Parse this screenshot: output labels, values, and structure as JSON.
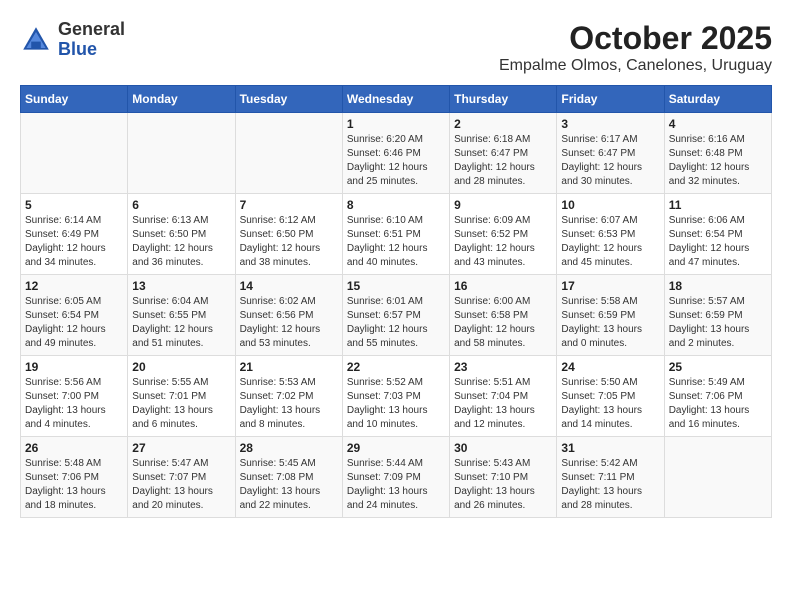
{
  "header": {
    "logo": {
      "general": "General",
      "blue": "Blue"
    },
    "title": "October 2025",
    "subtitle": "Empalme Olmos, Canelones, Uruguay"
  },
  "days_of_week": [
    "Sunday",
    "Monday",
    "Tuesday",
    "Wednesday",
    "Thursday",
    "Friday",
    "Saturday"
  ],
  "weeks": [
    [
      {
        "day": "",
        "info": ""
      },
      {
        "day": "",
        "info": ""
      },
      {
        "day": "",
        "info": ""
      },
      {
        "day": "1",
        "info": "Sunrise: 6:20 AM\nSunset: 6:46 PM\nDaylight: 12 hours\nand 25 minutes."
      },
      {
        "day": "2",
        "info": "Sunrise: 6:18 AM\nSunset: 6:47 PM\nDaylight: 12 hours\nand 28 minutes."
      },
      {
        "day": "3",
        "info": "Sunrise: 6:17 AM\nSunset: 6:47 PM\nDaylight: 12 hours\nand 30 minutes."
      },
      {
        "day": "4",
        "info": "Sunrise: 6:16 AM\nSunset: 6:48 PM\nDaylight: 12 hours\nand 32 minutes."
      }
    ],
    [
      {
        "day": "5",
        "info": "Sunrise: 6:14 AM\nSunset: 6:49 PM\nDaylight: 12 hours\nand 34 minutes."
      },
      {
        "day": "6",
        "info": "Sunrise: 6:13 AM\nSunset: 6:50 PM\nDaylight: 12 hours\nand 36 minutes."
      },
      {
        "day": "7",
        "info": "Sunrise: 6:12 AM\nSunset: 6:50 PM\nDaylight: 12 hours\nand 38 minutes."
      },
      {
        "day": "8",
        "info": "Sunrise: 6:10 AM\nSunset: 6:51 PM\nDaylight: 12 hours\nand 40 minutes."
      },
      {
        "day": "9",
        "info": "Sunrise: 6:09 AM\nSunset: 6:52 PM\nDaylight: 12 hours\nand 43 minutes."
      },
      {
        "day": "10",
        "info": "Sunrise: 6:07 AM\nSunset: 6:53 PM\nDaylight: 12 hours\nand 45 minutes."
      },
      {
        "day": "11",
        "info": "Sunrise: 6:06 AM\nSunset: 6:54 PM\nDaylight: 12 hours\nand 47 minutes."
      }
    ],
    [
      {
        "day": "12",
        "info": "Sunrise: 6:05 AM\nSunset: 6:54 PM\nDaylight: 12 hours\nand 49 minutes."
      },
      {
        "day": "13",
        "info": "Sunrise: 6:04 AM\nSunset: 6:55 PM\nDaylight: 12 hours\nand 51 minutes."
      },
      {
        "day": "14",
        "info": "Sunrise: 6:02 AM\nSunset: 6:56 PM\nDaylight: 12 hours\nand 53 minutes."
      },
      {
        "day": "15",
        "info": "Sunrise: 6:01 AM\nSunset: 6:57 PM\nDaylight: 12 hours\nand 55 minutes."
      },
      {
        "day": "16",
        "info": "Sunrise: 6:00 AM\nSunset: 6:58 PM\nDaylight: 12 hours\nand 58 minutes."
      },
      {
        "day": "17",
        "info": "Sunrise: 5:58 AM\nSunset: 6:59 PM\nDaylight: 13 hours\nand 0 minutes."
      },
      {
        "day": "18",
        "info": "Sunrise: 5:57 AM\nSunset: 6:59 PM\nDaylight: 13 hours\nand 2 minutes."
      }
    ],
    [
      {
        "day": "19",
        "info": "Sunrise: 5:56 AM\nSunset: 7:00 PM\nDaylight: 13 hours\nand 4 minutes."
      },
      {
        "day": "20",
        "info": "Sunrise: 5:55 AM\nSunset: 7:01 PM\nDaylight: 13 hours\nand 6 minutes."
      },
      {
        "day": "21",
        "info": "Sunrise: 5:53 AM\nSunset: 7:02 PM\nDaylight: 13 hours\nand 8 minutes."
      },
      {
        "day": "22",
        "info": "Sunrise: 5:52 AM\nSunset: 7:03 PM\nDaylight: 13 hours\nand 10 minutes."
      },
      {
        "day": "23",
        "info": "Sunrise: 5:51 AM\nSunset: 7:04 PM\nDaylight: 13 hours\nand 12 minutes."
      },
      {
        "day": "24",
        "info": "Sunrise: 5:50 AM\nSunset: 7:05 PM\nDaylight: 13 hours\nand 14 minutes."
      },
      {
        "day": "25",
        "info": "Sunrise: 5:49 AM\nSunset: 7:06 PM\nDaylight: 13 hours\nand 16 minutes."
      }
    ],
    [
      {
        "day": "26",
        "info": "Sunrise: 5:48 AM\nSunset: 7:06 PM\nDaylight: 13 hours\nand 18 minutes."
      },
      {
        "day": "27",
        "info": "Sunrise: 5:47 AM\nSunset: 7:07 PM\nDaylight: 13 hours\nand 20 minutes."
      },
      {
        "day": "28",
        "info": "Sunrise: 5:45 AM\nSunset: 7:08 PM\nDaylight: 13 hours\nand 22 minutes."
      },
      {
        "day": "29",
        "info": "Sunrise: 5:44 AM\nSunset: 7:09 PM\nDaylight: 13 hours\nand 24 minutes."
      },
      {
        "day": "30",
        "info": "Sunrise: 5:43 AM\nSunset: 7:10 PM\nDaylight: 13 hours\nand 26 minutes."
      },
      {
        "day": "31",
        "info": "Sunrise: 5:42 AM\nSunset: 7:11 PM\nDaylight: 13 hours\nand 28 minutes."
      },
      {
        "day": "",
        "info": ""
      }
    ]
  ]
}
